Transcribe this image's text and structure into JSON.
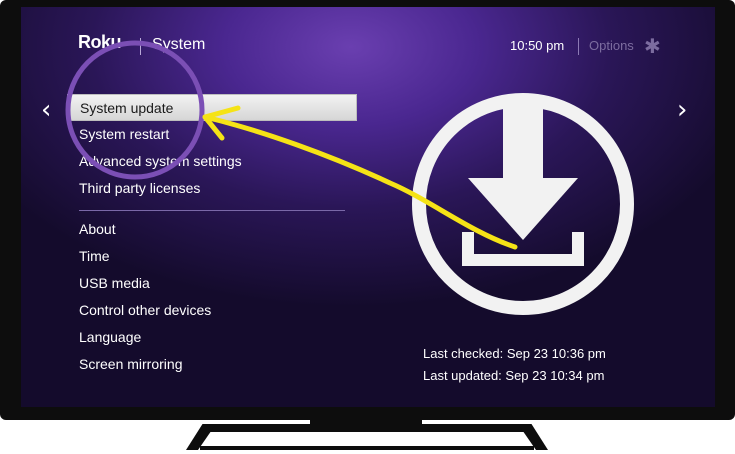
{
  "header": {
    "brand": "Roku",
    "title": "System",
    "clock": "10:50  pm",
    "options_label": "Options",
    "options_icon": "asterisk-icon"
  },
  "menu": {
    "group1": [
      "System update",
      "System restart",
      "Advanced system settings",
      "Third party licenses"
    ],
    "group2": [
      "About",
      "Time",
      "USB media",
      "Control other devices",
      "Language",
      "Screen mirroring"
    ],
    "selected": "System update"
  },
  "status": {
    "last_checked": "Last checked: Sep 23  10:36 pm",
    "last_updated": "Last updated: Sep 23  10:34 pm"
  },
  "icons": {
    "nav_left": "chevron-left-icon",
    "nav_right": "chevron-right-icon",
    "update": "download-circle-icon"
  },
  "colors": {
    "screen_center": "#6a3fb0",
    "screen_edge": "#140b2c",
    "annotation_circle": "#7b4fb5",
    "annotation_arrow": "#f5e316",
    "tv_frame": "#0d0d0d"
  }
}
